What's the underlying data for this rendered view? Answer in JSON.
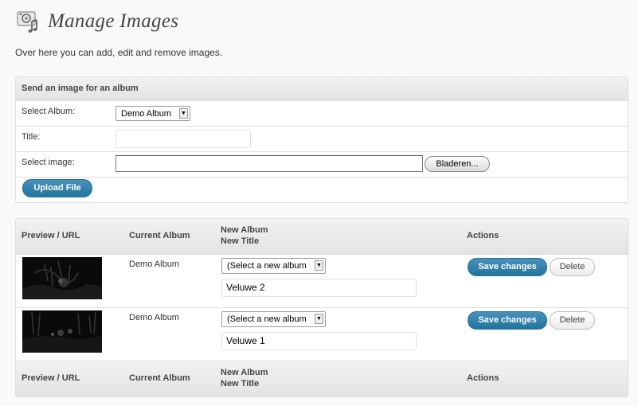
{
  "page": {
    "title": "Manage Images",
    "intro": "Over here you can add, edit and remove images.",
    "header_icon": "images-music-icon"
  },
  "upload_form": {
    "heading": "Send an image for an album",
    "album_label": "Select Album:",
    "album_selected": "Demo Album",
    "title_label": "Title:",
    "title_value": "",
    "image_label": "Select image:",
    "browse_label": "Bladeren...",
    "upload_label": "Upload File"
  },
  "images_table": {
    "columns": {
      "preview": "Preview / URL",
      "current_album": "Current Album",
      "new_album": "New Album",
      "new_title": "New Title",
      "actions": "Actions"
    },
    "rows": [
      {
        "current_album": "Demo Album",
        "album_select": "(Select a new album",
        "title_value": "Veluwe 2",
        "save_label": "Save changes",
        "delete_label": "Delete"
      },
      {
        "current_album": "Demo Album",
        "album_select": "(Select a new album",
        "title_value": "Veluwe 1",
        "save_label": "Save changes",
        "delete_label": "Delete"
      }
    ]
  },
  "colors": {
    "primary_button": "#21759b",
    "panel_header": "#e3e3e3",
    "border": "#dfdfdf"
  }
}
